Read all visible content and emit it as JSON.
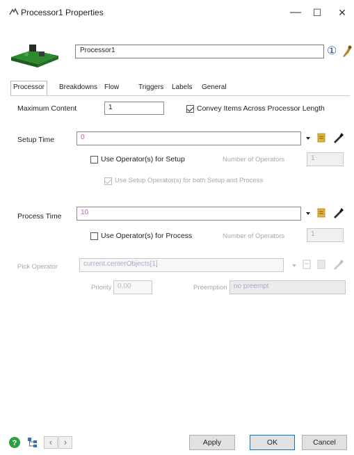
{
  "window": {
    "title": "Processor1 Properties",
    "icon": "processor-window-icon",
    "minimize": "—",
    "maximize": "☐",
    "close": "✕"
  },
  "header": {
    "name_value": "Processor1",
    "info_icon": "①"
  },
  "tabs": [
    "Processor",
    "Breakdowns",
    "Flow",
    "Triggers",
    "Labels",
    "General"
  ],
  "active_tab": "Processor",
  "processor": {
    "max_content_label": "Maximum Content",
    "max_content_value": "1",
    "convey_label": "Convey Items Across Processor Length",
    "convey_checked": true,
    "setup_time_label": "Setup Time",
    "setup_time_value": "0",
    "use_operator_setup_label": "Use Operator(s) for Setup",
    "use_operator_setup_checked": false,
    "num_operators_label": "Number of Operators",
    "num_operators_setup_value": "1",
    "use_setup_both_label": "Use Setup Operator(s) for both Setup and Process",
    "use_setup_both_checked": true,
    "process_time_label": "Process Time",
    "process_time_value": "10",
    "use_operator_process_label": "Use Operator(s) for Process",
    "use_operator_process_checked": false,
    "num_operators_process_value": "1",
    "pick_operator_label": "Pick Operator",
    "pick_operator_value": "current.centerObjects[1]",
    "priority_label": "Priority",
    "priority_value": "0.00",
    "preemption_label": "Preemption",
    "preemption_value": "no preempt"
  },
  "footer": {
    "apply": "Apply",
    "ok": "OK",
    "cancel": "Cancel",
    "prev": "‹",
    "next": "›"
  }
}
